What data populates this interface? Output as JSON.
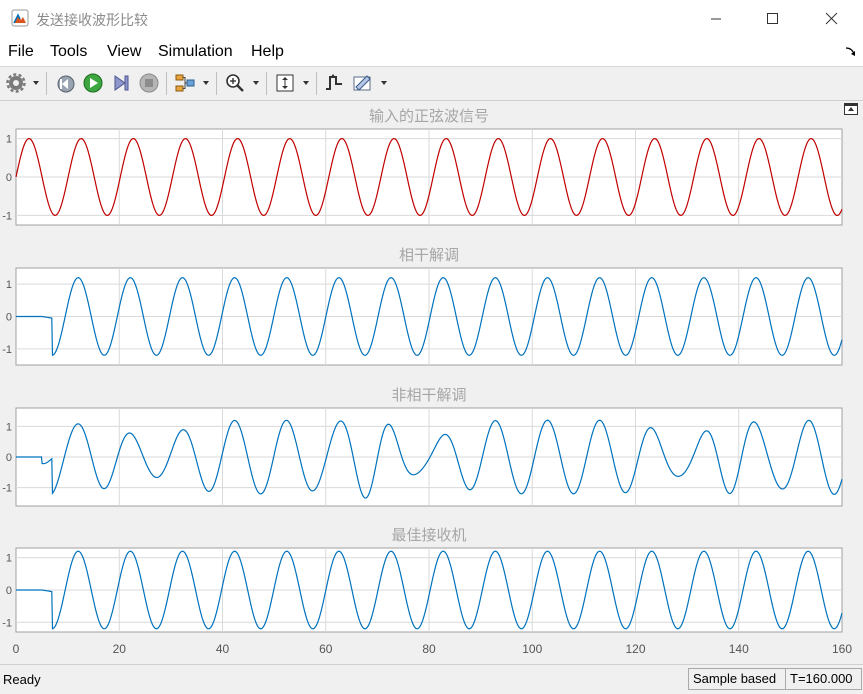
{
  "window": {
    "title": "发送接收波形比较",
    "icon": "matlab-scope-icon",
    "controls": [
      "minimize-icon",
      "maximize-icon",
      "close-icon"
    ]
  },
  "menu": [
    "File",
    "Tools",
    "View",
    "Simulation",
    "Help"
  ],
  "toolbar": {
    "icons": [
      "settings-gear-icon",
      "step-back-icon",
      "run-icon",
      "step-forward-icon",
      "stop-icon",
      "signal-layout-icon",
      "zoom-in-icon",
      "autoscale-icon",
      "trigger-icon",
      "measure-icon"
    ]
  },
  "colors": {
    "sine": "#c00000",
    "demod": "#0072bd",
    "title_gray": "#a6a6a6",
    "grid": "#d9d9d9"
  },
  "chart_data": [
    {
      "type": "line",
      "title": "输入的正弦波信号",
      "xlim": [
        0,
        160
      ],
      "ylim": [
        -1.25,
        1.25
      ],
      "yticks": [
        1,
        0,
        -1
      ],
      "grid": true,
      "series": [
        {
          "model": "sine",
          "amplitude": 1,
          "period": 10.1,
          "phase_deg": 0,
          "color": "#c00000"
        }
      ]
    },
    {
      "type": "line",
      "title": "相干解调",
      "xlim": [
        0,
        160
      ],
      "ylim": [
        -1.5,
        1.5
      ],
      "yticks": [
        1,
        0,
        -1
      ],
      "grid": true,
      "series": [
        {
          "model": "delayed_sine",
          "amplitude": 1.2,
          "period": 10.1,
          "start": 7,
          "phase_deg": 270,
          "color": "#0072bd"
        }
      ]
    },
    {
      "type": "line",
      "title": "非相干解调",
      "xlim": [
        0,
        160
      ],
      "ylim": [
        -1.6,
        1.6
      ],
      "yticks": [
        1,
        0,
        -1
      ],
      "grid": true,
      "series": [
        {
          "model": "delayed_sine_distorted",
          "amplitude": 1.2,
          "period": 10.1,
          "start": 7,
          "phase_deg": 270,
          "color": "#0072bd"
        }
      ]
    },
    {
      "type": "line",
      "title": "最佳接收机",
      "xlim": [
        0,
        160
      ],
      "ylim": [
        -1.3,
        1.3
      ],
      "yticks": [
        1,
        0,
        -1
      ],
      "grid": true,
      "xticks": [
        0,
        20,
        40,
        60,
        80,
        100,
        120,
        140,
        160
      ],
      "series": [
        {
          "model": "delayed_sine",
          "amplitude": 1.2,
          "period": 10.1,
          "start": 7,
          "phase_deg": 270,
          "color": "#0072bd"
        }
      ]
    }
  ],
  "status": {
    "left": "Ready",
    "mode": "Sample based",
    "time": "T=160.000"
  }
}
